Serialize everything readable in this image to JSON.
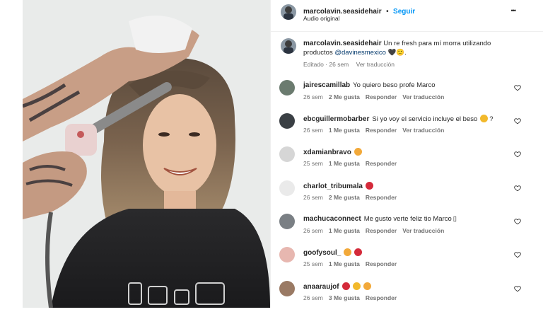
{
  "post": {
    "author": "marcolavin.seasidehair",
    "dot": "•",
    "follow_label": "Seguir",
    "audio": "Audio original",
    "more": "•••"
  },
  "caption": {
    "user": "marcolavin.seasidehair",
    "text_part1": "Un re fresh para mí morra utilizando",
    "text_part2": "productos",
    "mention": "@davinesmexico",
    "text_part3": "🖤🙂.",
    "meta": "Editado · 26 sem",
    "see_translation": "Ver traducción"
  },
  "comments": [
    {
      "user": "jairescamillab",
      "text": "Yo quiero beso profe Marco",
      "time": "26 sem",
      "likes": "2 Me gusta",
      "reply": "Responder",
      "translate": "Ver traducción",
      "emojis": []
    },
    {
      "user": "ebcguillermobarber",
      "text": "Si yo voy el servicio incluye el beso",
      "suffix": "?",
      "time": "26 sem",
      "likes": "1 Me gusta",
      "reply": "Responder",
      "translate": "Ver traducción",
      "emojis": [
        "#f2b92c"
      ]
    },
    {
      "user": "xdamianbravo",
      "text": "",
      "time": "25 sem",
      "likes": "1 Me gusta",
      "reply": "Responder",
      "translate": "",
      "emojis": [
        "#f2a93a"
      ]
    },
    {
      "user": "charlot_tribumala",
      "text": "",
      "time": "26 sem",
      "likes": "2 Me gusta",
      "reply": "Responder",
      "translate": "",
      "emojis": [
        "#d42a3a"
      ]
    },
    {
      "user": "machucaconnect",
      "text": "Me gusto verte feliz tio Marco",
      "suffix": "▯",
      "time": "26 sem",
      "likes": "1 Me gusta",
      "reply": "Responder",
      "translate": "Ver traducción",
      "emojis": []
    },
    {
      "user": "goofysoul_",
      "text": "",
      "time": "25 sem",
      "likes": "1 Me gusta",
      "reply": "Responder",
      "translate": "",
      "emojis": [
        "#f2a93a",
        "#d42a3a"
      ]
    },
    {
      "user": "anaaraujof",
      "text": "",
      "time": "26 sem",
      "likes": "3 Me gusta",
      "reply": "Responder",
      "translate": "",
      "emojis": [
        "#d42a3a",
        "#f2b92c",
        "#f2a93a"
      ]
    }
  ],
  "colors": {
    "link_blue": "#0095f6",
    "mention": "#00376b",
    "muted": "#737373"
  }
}
